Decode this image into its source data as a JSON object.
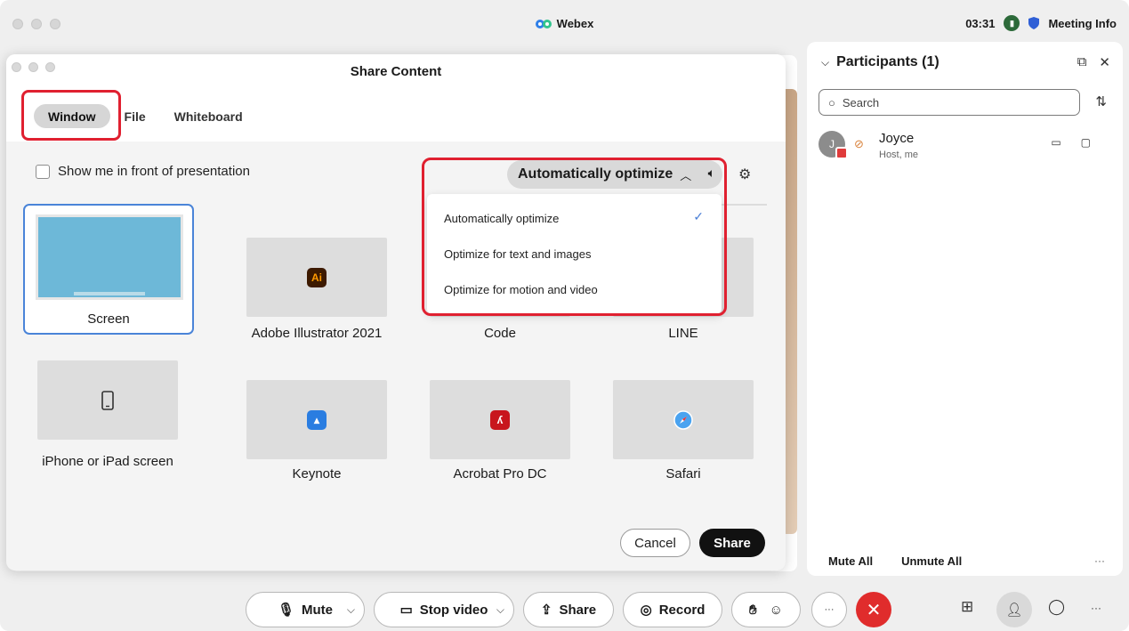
{
  "app": {
    "title": "Webex",
    "time": "03:31",
    "meeting_info": "Meeting Info"
  },
  "participants": {
    "title": "Participants (1)",
    "search_placeholder": "Search",
    "list": [
      {
        "initial": "J",
        "name": "Joyce",
        "role": "Host, me"
      }
    ],
    "mute_all": "Mute All",
    "unmute_all": "Unmute All",
    "more": "···"
  },
  "dialog": {
    "title": "Share Content",
    "tabs": [
      {
        "label": "Window",
        "active": true
      },
      {
        "label": "File",
        "active": false
      },
      {
        "label": "Whiteboard",
        "active": false
      }
    ],
    "show_me_label": "Show me in front of presentation",
    "optimize_selected": "Automatically optimize",
    "optimize_options": [
      {
        "label": "Automatically optimize",
        "checked": true
      },
      {
        "label": "Optimize for text and images",
        "checked": false
      },
      {
        "label": "Optimize for motion and video",
        "checked": false
      }
    ],
    "sources": [
      {
        "label": "Screen",
        "icon": "desktop-screenshot"
      },
      {
        "label": "Adobe Illustrator 2021",
        "icon": "illustrator-icon",
        "glyph": "Ai",
        "color": "#3d1a00",
        "fg": "#ff9a00"
      },
      {
        "label": "Code",
        "icon": "vscode-icon"
      },
      {
        "label": "LINE",
        "icon": "line-icon"
      },
      {
        "label": "iPhone or iPad screen",
        "icon": "phone-icon"
      },
      {
        "label": "Keynote",
        "icon": "keynote-icon",
        "color": "#2a7de1"
      },
      {
        "label": "Acrobat Pro DC",
        "icon": "acrobat-icon",
        "color": "#c8161d"
      },
      {
        "label": "Safari",
        "icon": "safari-icon",
        "color": "#4aa3f0"
      }
    ],
    "cancel": "Cancel",
    "share": "Share"
  },
  "toolbar": {
    "mute": "Mute",
    "stop_video": "Stop video",
    "share": "Share",
    "record": "Record",
    "more": "···"
  },
  "colors": {
    "highlight": "#e02030",
    "selection": "#4a84d8",
    "end_call": "#e02c2c",
    "check": "#4a7fd6"
  }
}
